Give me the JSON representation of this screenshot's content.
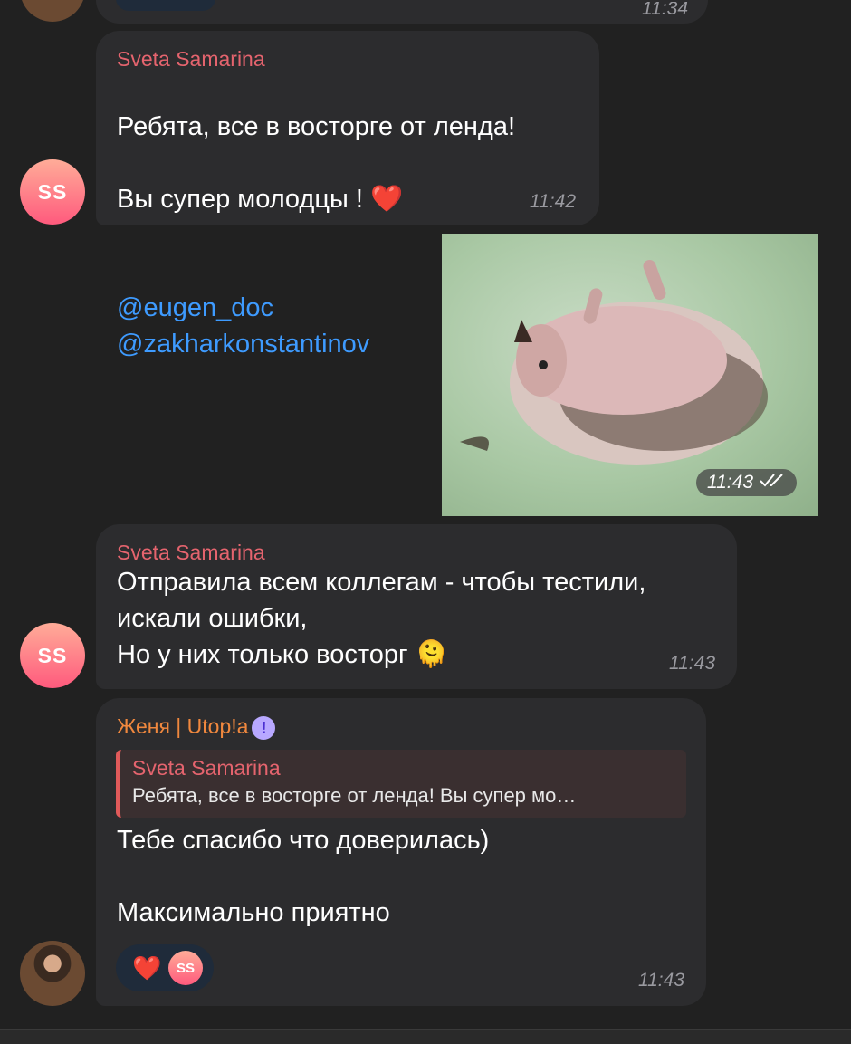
{
  "top_partial": {
    "time": "11:34"
  },
  "messages": [
    {
      "sender": "Sveta Samarina",
      "avatar_initials": "SS",
      "lines": [
        "Ребята, все в восторге от ленда!",
        "Вы супер молодцы ! ❤️"
      ],
      "mentions": [
        "@eugen_doc",
        "@zakharkonstantinov"
      ],
      "time": "11:42"
    },
    {
      "type": "media",
      "media_icon": "hedgehog-video-thumbnail",
      "time": "11:43",
      "status_icon": "double-check-icon"
    },
    {
      "sender": "Sveta Samarina",
      "avatar_initials": "SS",
      "text": "Отправила всем коллегам - чтобы тестили,\nискали ошибки,\nНо у них только восторг 🫠",
      "time": "11:43"
    },
    {
      "sender": "Женя | Utop!a",
      "verified_badge": "!",
      "reply": {
        "sender": "Sveta Samarina",
        "text": "Ребята, все в восторге от ленда! Вы супер мо…"
      },
      "text": "Тебе спасибо что доверилась)\n\nМаксимально приятно",
      "reaction": {
        "emoji": "❤️",
        "avatar_initials": "SS"
      },
      "time": "11:43"
    }
  ],
  "colors": {
    "background": "#212121",
    "bubble": "#2c2c2e",
    "sveta_name": "#e5646e",
    "zhenya_name": "#f0883e",
    "mention": "#3e9bff",
    "time": "#9a9aa0"
  }
}
